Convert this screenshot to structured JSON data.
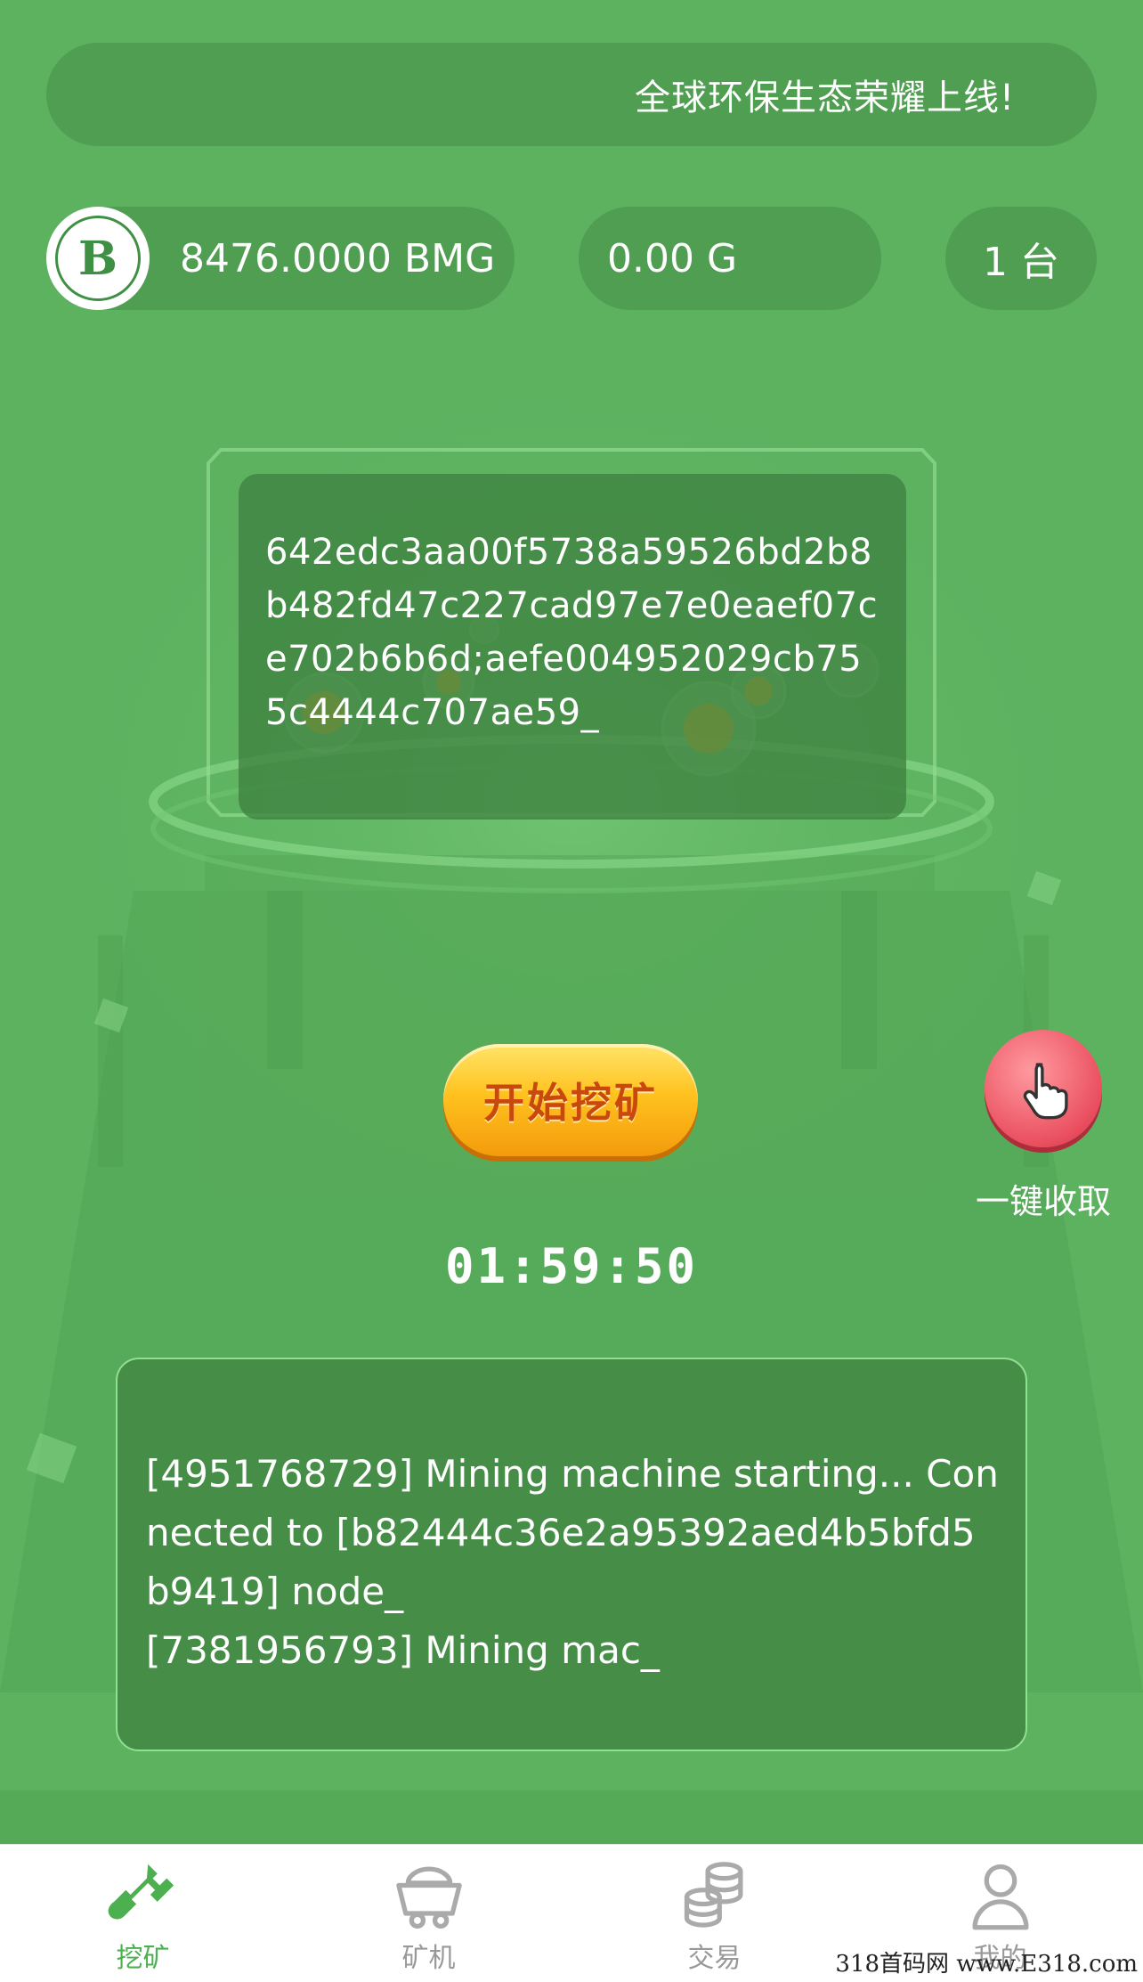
{
  "marquee": {
    "text": "全球环保生态荣耀上线!"
  },
  "stats": {
    "balance": "8476.0000 BMG",
    "power": "0.00 G",
    "machines": "1 台"
  },
  "logo": {
    "letter": "B"
  },
  "hash_screen": {
    "text": "642edc3aa00f5738a59526bd2b8b482fd47c227cad97e7e0eaef07ce702b6b6d;aefe004952029cb755c4444c707ae59_"
  },
  "start_button": {
    "label": "开始挖矿"
  },
  "collect_button": {
    "label": "一键收取"
  },
  "timer": {
    "value": "01:59:50"
  },
  "log": {
    "lines": [
      "[4951768729] Mining machine starting... Connected to [b82444c36e2a95392aed4b5bfd5b9419] node_",
      "[7381956793] Mining mac_"
    ]
  },
  "tabs": [
    {
      "label": "挖矿",
      "icon": "shovel-icon",
      "active": true
    },
    {
      "label": "矿机",
      "icon": "mine-cart-icon",
      "active": false
    },
    {
      "label": "交易",
      "icon": "coins-icon",
      "active": false
    },
    {
      "label": "我的",
      "icon": "user-icon",
      "active": false
    }
  ],
  "watermark": "318首码网 www.E318.com",
  "colors": {
    "background": "#5cb25f",
    "panel": "#4f9e52",
    "accent": "#4caf50",
    "button": "#ffc21f"
  }
}
